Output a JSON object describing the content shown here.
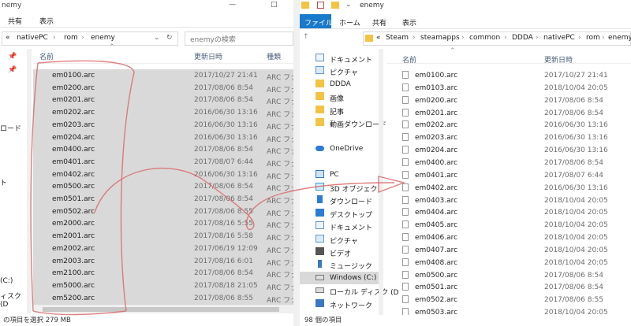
{
  "left": {
    "title": "nemy",
    "ribbon_tabs": [
      "共有",
      "表示"
    ],
    "breadcrumb": [
      "«",
      "nativePC",
      "rom",
      "enemy"
    ],
    "search_placeholder": "enemyの検索",
    "columns": {
      "name": "名前",
      "date": "更新日時",
      "type": "種類"
    },
    "nav_fragments": [
      "ロード",
      "ト",
      "(C:)",
      "ィスク (D"
    ],
    "files": [
      {
        "name": "em0100.arc",
        "date": "2017/10/27 21:41",
        "type": "ARC ファイ"
      },
      {
        "name": "em0200.arc",
        "date": "2017/08/06 8:54",
        "type": "ARC ファイ"
      },
      {
        "name": "em0201.arc",
        "date": "2017/08/06 8:54",
        "type": "ARC ファイ"
      },
      {
        "name": "em0202.arc",
        "date": "2016/06/30 13:16",
        "type": "ARC ファイ"
      },
      {
        "name": "em0203.arc",
        "date": "2016/06/30 13:16",
        "type": "ARC ファイ"
      },
      {
        "name": "em0204.arc",
        "date": "2016/06/30 13:16",
        "type": "ARC ファイ"
      },
      {
        "name": "em0400.arc",
        "date": "2017/08/06 8:54",
        "type": "ARC ファイ"
      },
      {
        "name": "em0401.arc",
        "date": "2017/08/07 6:44",
        "type": "ARC ファイ"
      },
      {
        "name": "em0402.arc",
        "date": "2016/06/30 13:16",
        "type": "ARC ファイ"
      },
      {
        "name": "em0500.arc",
        "date": "2017/08/06 8:54",
        "type": "ARC ファイ"
      },
      {
        "name": "em0501.arc",
        "date": "2017/08/06 8:54",
        "type": "ARC ファイ"
      },
      {
        "name": "em0502.arc",
        "date": "2017/08/06 8:55",
        "type": "ARC ファイ"
      },
      {
        "name": "em2000.arc",
        "date": "2017/08/16 5:55",
        "type": "ARC ファイ"
      },
      {
        "name": "em2001.arc",
        "date": "2017/08/16 5:58",
        "type": "ARC ファイ"
      },
      {
        "name": "em2002.arc",
        "date": "2017/06/19 12:09",
        "type": "ARC ファイ"
      },
      {
        "name": "em2003.arc",
        "date": "2017/08/16 6:01",
        "type": "ARC ファイ"
      },
      {
        "name": "em2100.arc",
        "date": "2017/08/06 8:54",
        "type": "ARC ファイ"
      },
      {
        "name": "em5000.arc",
        "date": "2017/08/18 21:05",
        "type": "ARC ファイ"
      },
      {
        "name": "em5200.arc",
        "date": "2017/08/06 8:55",
        "type": "ARC ファイ"
      }
    ],
    "status": "の項目を選択  279 MB"
  },
  "right": {
    "title": "enemy",
    "ribbon_tabs": [
      "ファイル",
      "ホーム",
      "共有",
      "表示"
    ],
    "breadcrumb": [
      "«",
      "Steam",
      "steamapps",
      "common",
      "DDDA",
      "nativePC",
      "rom",
      "enemy"
    ],
    "columns": {
      "name": "名前",
      "date": "更新日時"
    },
    "nav": [
      {
        "label": "ドキュメント",
        "icon": "documents"
      },
      {
        "label": "ピクチャ",
        "icon": "pictures"
      },
      {
        "label": "DDDA",
        "icon": "folder"
      },
      {
        "label": "画像",
        "icon": "folder"
      },
      {
        "label": "記事",
        "icon": "folder"
      },
      {
        "label": "動画ダウンロード",
        "icon": "folder"
      },
      {
        "label": "",
        "icon": ""
      },
      {
        "label": "OneDrive",
        "icon": "cloud"
      },
      {
        "label": "",
        "icon": ""
      },
      {
        "label": "PC",
        "icon": "pc"
      },
      {
        "label": "3D オブジェクト",
        "icon": "cube"
      },
      {
        "label": "ダウンロード",
        "icon": "download"
      },
      {
        "label": "デスクトップ",
        "icon": "desktop"
      },
      {
        "label": "ドキュメント",
        "icon": "documents"
      },
      {
        "label": "ピクチャ",
        "icon": "pictures"
      },
      {
        "label": "ビデオ",
        "icon": "video"
      },
      {
        "label": "ミュージック",
        "icon": "music"
      },
      {
        "label": "Windows (C:)",
        "icon": "drive"
      },
      {
        "label": "ローカル ディスク (D",
        "icon": "drive"
      },
      {
        "label": "ネットワーク",
        "icon": "network"
      }
    ],
    "files": [
      {
        "name": "em0100.arc",
        "date": "2017/10/27 21:41"
      },
      {
        "name": "em0103.arc",
        "date": "2018/10/04 20:05"
      },
      {
        "name": "em0200.arc",
        "date": "2017/08/06 8:54"
      },
      {
        "name": "em0201.arc",
        "date": "2017/08/06 8:54"
      },
      {
        "name": "em0202.arc",
        "date": "2016/06/30 13:16"
      },
      {
        "name": "em0203.arc",
        "date": "2016/06/30 13:16"
      },
      {
        "name": "em0204.arc",
        "date": "2016/06/30 13:16"
      },
      {
        "name": "em0400.arc",
        "date": "2017/08/06 8:54"
      },
      {
        "name": "em0401.arc",
        "date": "2017/08/07 6:44"
      },
      {
        "name": "em0402.arc",
        "date": "2016/06/30 13:16"
      },
      {
        "name": "em0403.arc",
        "date": "2018/10/04 20:05"
      },
      {
        "name": "em0404.arc",
        "date": "2018/10/04 20:05"
      },
      {
        "name": "em0405.arc",
        "date": "2018/10/04 20:05"
      },
      {
        "name": "em0406.arc",
        "date": "2018/10/04 20:05"
      },
      {
        "name": "em0407.arc",
        "date": "2018/10/04 20:05"
      },
      {
        "name": "em0408.arc",
        "date": "2018/10/04 20:05"
      },
      {
        "name": "em0500.arc",
        "date": "2017/08/06 8:54"
      },
      {
        "name": "em0501.arc",
        "date": "2017/08/06 8:54"
      },
      {
        "name": "em0502.arc",
        "date": "2017/08/06 8:55"
      },
      {
        "name": "em0503.arc",
        "date": "2018/10/04 20:05"
      }
    ],
    "status": "98 個の項目"
  },
  "colors": {
    "selection": "#d9d9d9",
    "file_tab": "#1979ca",
    "annotation": "#d96a6a",
    "folder": "#f5c342"
  }
}
